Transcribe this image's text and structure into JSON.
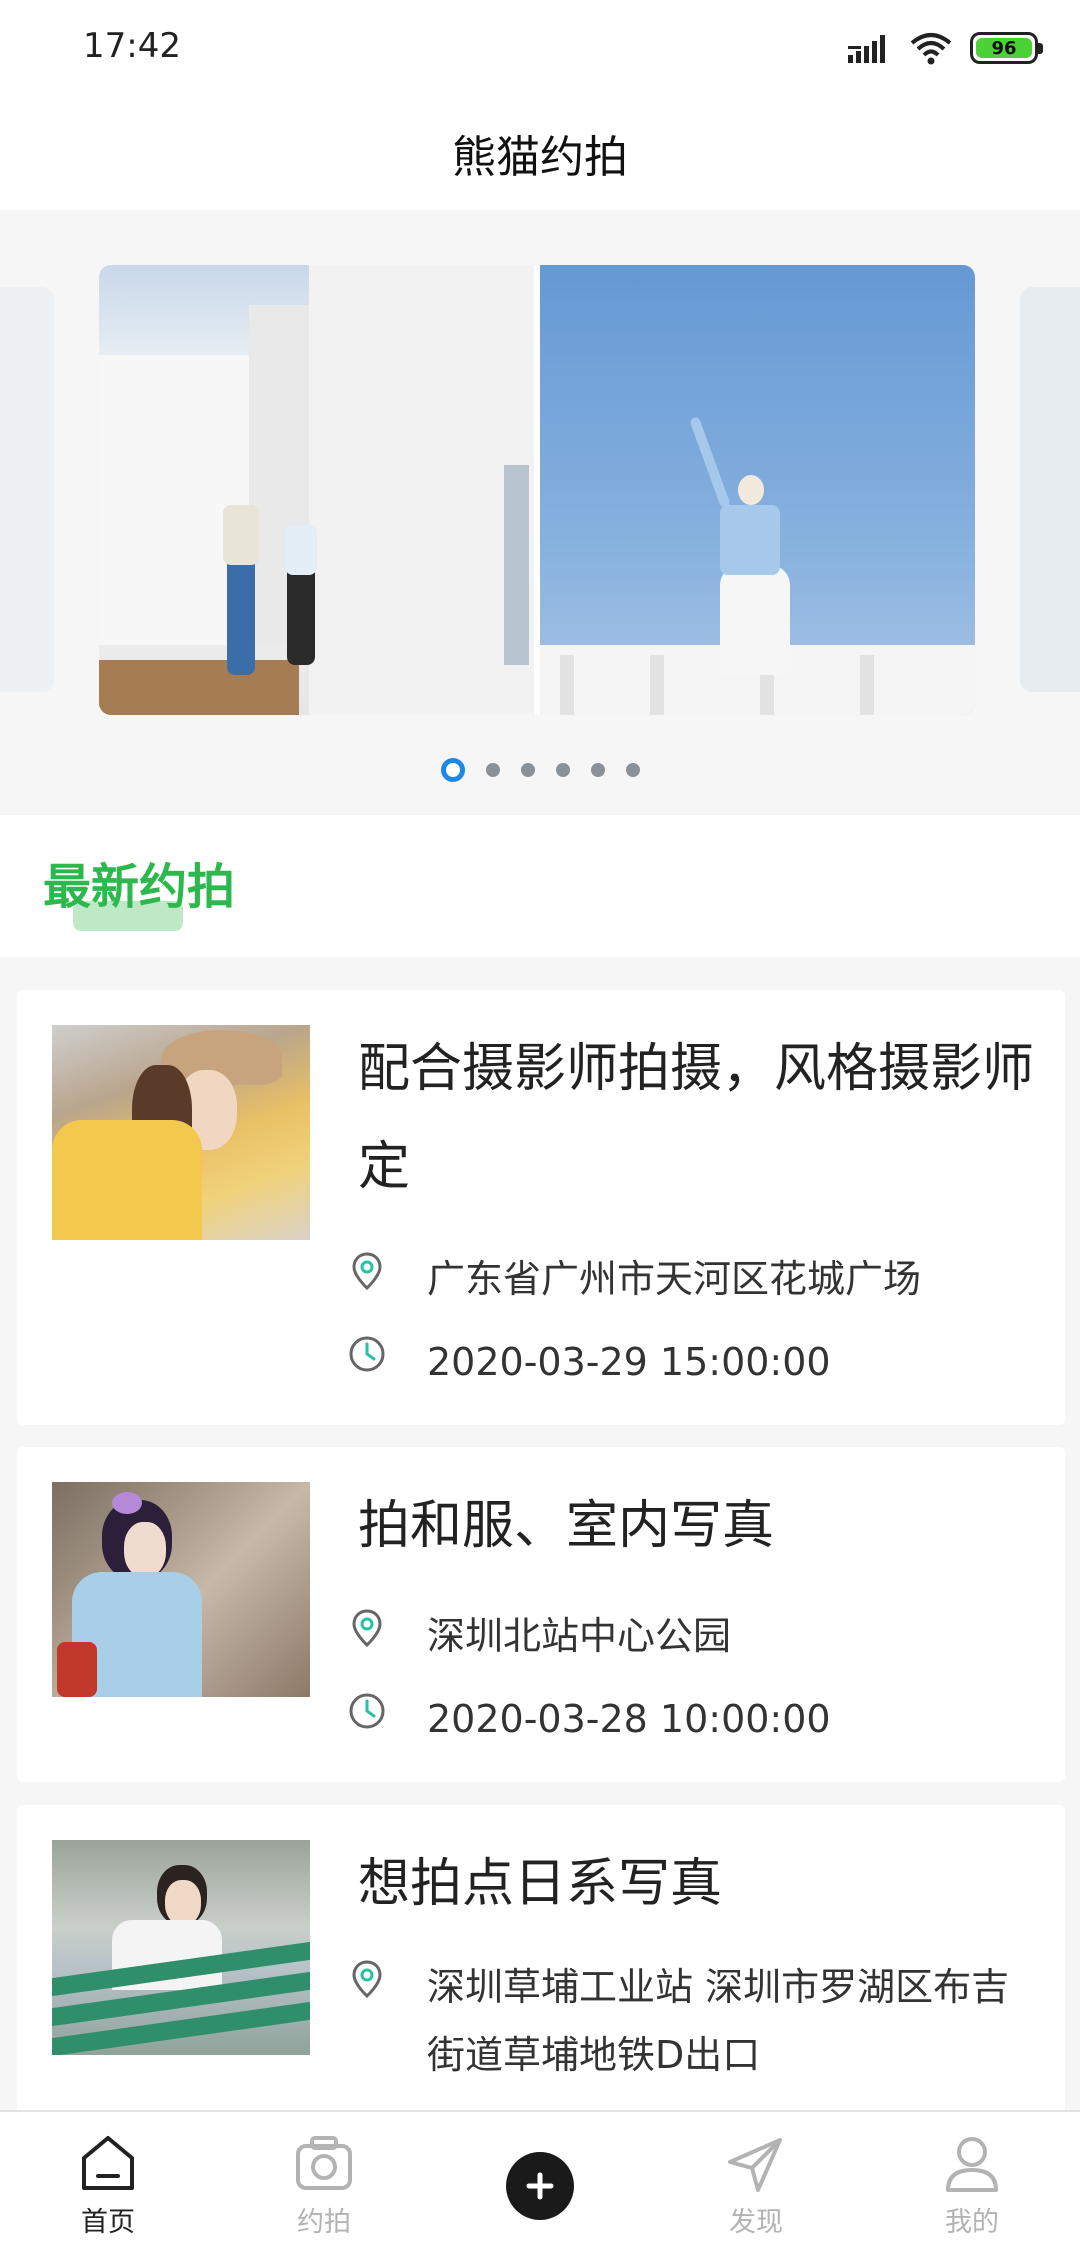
{
  "status_bar": {
    "time": "17:42",
    "battery_level": "96",
    "icons": [
      "signal-icon",
      "wifi-icon",
      "battery-icon"
    ]
  },
  "header": {
    "title": "熊猫约拍"
  },
  "banner": {
    "slide_count": 6,
    "active_index": 0
  },
  "section": {
    "title": "最新约拍",
    "accent_color": "#2db84d"
  },
  "posts": [
    {
      "title": "配合摄影师拍摄，风格摄影师定",
      "location": "广东省广州市天河区花城广场",
      "datetime": "2020-03-29 15:00:00"
    },
    {
      "title": "拍和服、室内写真",
      "location": "深圳北站中心公园",
      "datetime": "2020-03-28 10:00:00"
    },
    {
      "title": "想拍点日系写真",
      "location": "深圳草埔工业站 深圳市罗湖区布吉街道草埔地铁D出口",
      "datetime": ""
    }
  ],
  "tab_bar": {
    "tabs": [
      {
        "label": "首页",
        "icon": "home-icon",
        "active": true
      },
      {
        "label": "约拍",
        "icon": "camera-icon",
        "active": false
      },
      {
        "label": "",
        "icon": "add-icon",
        "active": false
      },
      {
        "label": "发现",
        "icon": "paper-plane-icon",
        "active": false
      },
      {
        "label": "我的",
        "icon": "user-icon",
        "active": false
      }
    ],
    "active_color": "#222222",
    "inactive_color": "#b3b3b3"
  }
}
